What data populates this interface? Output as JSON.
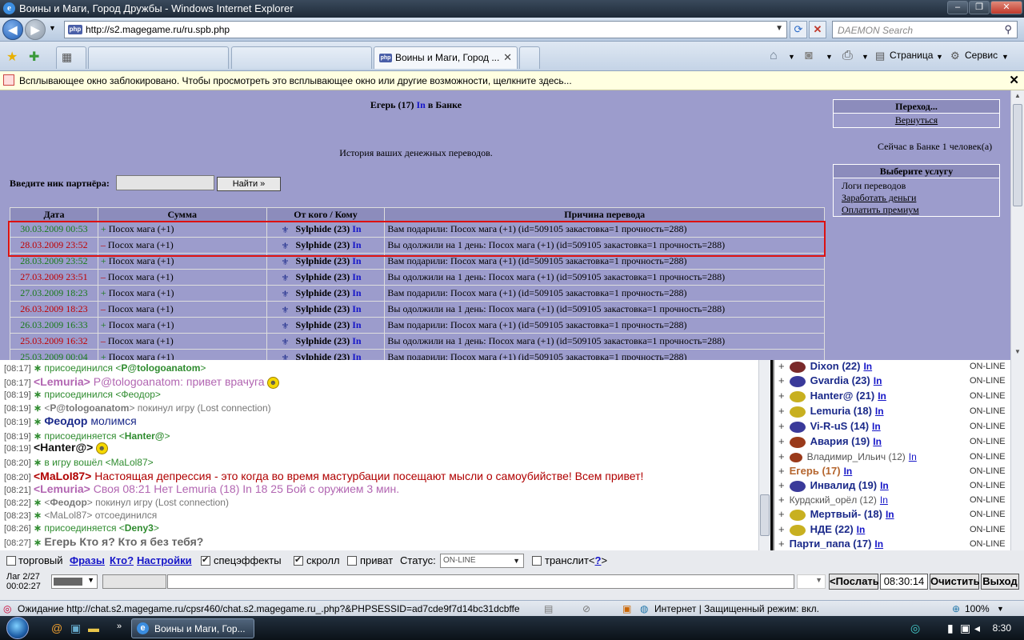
{
  "window": {
    "title": "Воины и Маги, Город Дружбы - Windows Internet Explorer",
    "minimize": "–",
    "maximize": "❐",
    "close": "✕"
  },
  "nav": {
    "url": "http://s2.magegame.ru/ru.spb.php",
    "search_placeholder": "DAEMON Search"
  },
  "tabs": {
    "active_title": "Воины и Маги, Город ...",
    "commands": [
      "Страница",
      "Сервис"
    ]
  },
  "infobar": {
    "text": "Всплывающее окно заблокировано. Чтобы просмотреть это всплывающее окно или другие возможности, щелкните здесь..."
  },
  "bank": {
    "header_name": "Егерь (17)",
    "header_in": "In",
    "header_place": "в Банке",
    "subtitle": "История ваших денежных переводов.",
    "partner_label": "Введите ник партнёра:",
    "find_button": "Найти »",
    "columns": [
      "Дата",
      "Сумма",
      "От кого / Кому",
      "Причина перевода"
    ],
    "rows": [
      {
        "date": "30.03.2009 00:53",
        "sign": "+",
        "amount": "Посох мага (+1)",
        "who": "Sylphide (23)",
        "in": "In",
        "reason": "Вам подарили: Посох мага (+1) (id=509105 закастовка=1 прочность=288)",
        "color": "#1a7a1a"
      },
      {
        "date": "28.03.2009 23:52",
        "sign": "–",
        "amount": "Посох мага (+1)",
        "who": "Sylphide (23)",
        "in": "In",
        "reason": "Вы одолжили на 1 день: Посох мага (+1) (id=509105 закастовка=1 прочность=288)",
        "color": "#c00000"
      },
      {
        "date": "28.03.2009 23:52",
        "sign": "+",
        "amount": "Посох мага (+1)",
        "who": "Sylphide (23)",
        "in": "In",
        "reason": "Вам подарили: Посох мага (+1) (id=509105 закастовка=1 прочность=288)",
        "color": "#1a7a1a"
      },
      {
        "date": "27.03.2009 23:51",
        "sign": "–",
        "amount": "Посох мага (+1)",
        "who": "Sylphide (23)",
        "in": "In",
        "reason": "Вы одолжили на 1 день: Посох мага (+1) (id=509105 закастовка=1 прочность=288)",
        "color": "#c00000"
      },
      {
        "date": "27.03.2009 18:23",
        "sign": "+",
        "amount": "Посох мага (+1)",
        "who": "Sylphide (23)",
        "in": "In",
        "reason": "Вам подарили: Посох мага (+1) (id=509105 закастовка=1 прочность=288)",
        "color": "#1a7a1a"
      },
      {
        "date": "26.03.2009 18:23",
        "sign": "–",
        "amount": "Посох мага (+1)",
        "who": "Sylphide (23)",
        "in": "In",
        "reason": "Вы одолжили на 1 день: Посох мага (+1) (id=509105 закастовка=1 прочность=288)",
        "color": "#c00000"
      },
      {
        "date": "26.03.2009 16:33",
        "sign": "+",
        "amount": "Посох мага (+1)",
        "who": "Sylphide (23)",
        "in": "In",
        "reason": "Вам подарили: Посох мага (+1) (id=509105 закастовка=1 прочность=288)",
        "color": "#1a7a1a"
      },
      {
        "date": "25.03.2009 16:32",
        "sign": "–",
        "amount": "Посох мага (+1)",
        "who": "Sylphide (23)",
        "in": "In",
        "reason": "Вы одолжили на 1 день: Посох мага (+1) (id=509105 закастовка=1 прочность=288)",
        "color": "#c00000"
      },
      {
        "date": "25.03.2009 00:04",
        "sign": "+",
        "amount": "Посох мага (+1)",
        "who": "Sylphide (23)",
        "in": "In",
        "reason": "Вам подарили: Посох мага (+1) (id=509105 закастовка=1 прочность=288)",
        "color": "#1a7a1a"
      }
    ],
    "nav_box": {
      "title": "Переход...",
      "link": "Вернуться"
    },
    "count_text": "Сейчас в Банке 1 человек(а)",
    "services_box": {
      "title": "Выберите услугу",
      "items": [
        "Логи переводов",
        "Заработать деньги",
        "Оплатить премиум"
      ]
    }
  },
  "chat": {
    "lines": [
      {
        "time": "[08:17]",
        "star": "∗",
        "parts": [
          {
            "t": "присоединился <",
            "c": "g"
          },
          {
            "t": "P@tologoanatom",
            "c": "nkb"
          },
          {
            "t": ">",
            "c": "g"
          }
        ]
      },
      {
        "time": "[08:17]",
        "parts": [
          {
            "t": "<Lemuria>",
            "c": "lemb"
          },
          {
            "t": " P@tologoanatom: привет врачуга",
            "c": "lem"
          }
        ],
        "smile": "😁"
      },
      {
        "time": "[08:19]",
        "star": "∗",
        "parts": [
          {
            "t": "присоединился <Феодор>",
            "c": "g"
          }
        ]
      },
      {
        "time": "[08:19]",
        "star": "∗",
        "parts": [
          {
            "t": "<",
            "c": "sys"
          },
          {
            "t": "P@tologoanatom",
            "c": "sysb"
          },
          {
            "t": "> покинул игру (Lost connection)",
            "c": "sys"
          }
        ]
      },
      {
        "time": "[08:19]",
        "star": "∗",
        "parts": [
          {
            "t": "Феодор",
            "c": "teo"
          },
          {
            "t": " молимся",
            "c": "teon"
          }
        ]
      },
      {
        "time": "[08:19]",
        "star": "∗",
        "parts": [
          {
            "t": "присоединяется <",
            "c": "g"
          },
          {
            "t": "Hanter@",
            "c": "nkb"
          },
          {
            "t": ">",
            "c": "g"
          }
        ]
      },
      {
        "time": "[08:19]",
        "parts": [
          {
            "t": "<Hanter@>",
            "c": "blkb"
          }
        ],
        "smile": "😁"
      },
      {
        "time": "[08:20]",
        "star": "∗",
        "parts": [
          {
            "t": "в игру вошёл <MaLol87>",
            "c": "g"
          }
        ]
      },
      {
        "time": "[08:20]",
        "parts": [
          {
            "t": "<MaLoI87>",
            "c": "malb"
          },
          {
            "t": " Настоящая депрессия - это когда во время мастурбации посещают мысли о самоубийстве! Всем привет!",
            "c": "mal"
          }
        ]
      },
      {
        "time": "[08:21]",
        "parts": [
          {
            "t": "<Lemuria>",
            "c": "lemb"
          },
          {
            "t": " Своя 08:21 Нет Lemuria (18) In 18 25 Бой с оружием 3 мин.",
            "c": "lem"
          }
        ]
      },
      {
        "time": "[08:22]",
        "star": "∗",
        "parts": [
          {
            "t": "<",
            "c": "sys"
          },
          {
            "t": "Феодор",
            "c": "sysb"
          },
          {
            "t": "> покинул игру (Lost connection)",
            "c": "sys"
          }
        ]
      },
      {
        "time": "[08:23]",
        "star": "∗",
        "parts": [
          {
            "t": "<MaLol87> отсоединился",
            "c": "sys"
          }
        ]
      },
      {
        "time": "[08:26]",
        "star": "∗",
        "parts": [
          {
            "t": "присоединяется <",
            "c": "g"
          },
          {
            "t": "Deny3",
            "c": "nkb"
          },
          {
            "t": ">",
            "c": "g"
          }
        ]
      },
      {
        "time": "[08:27]",
        "star": "∗",
        "parts": [
          {
            "t": "Егерь Кто я? Кто я без тебя?",
            "c": "egr"
          }
        ]
      }
    ]
  },
  "users": [
    {
      "name": "Dixon (22)",
      "in": "In",
      "status": "ON-LINE",
      "icon": "#7a2a2a",
      "style": "bold"
    },
    {
      "name": "Gvardia (23)",
      "in": "In",
      "status": "ON-LINE",
      "icon": "#3a3a9a",
      "style": "bold"
    },
    {
      "name": "Hanter@ (21)",
      "in": "In",
      "status": "ON-LINE",
      "icon": "#c8b020",
      "style": "bold"
    },
    {
      "name": "Lemuria (18)",
      "in": "In",
      "status": "ON-LINE",
      "icon": "#c8b020",
      "style": "bold"
    },
    {
      "name": "Vi-R-uS (14)",
      "in": "In",
      "status": "ON-LINE",
      "icon": "#3a3a9a",
      "style": "bold"
    },
    {
      "name": "Авария (19)",
      "in": "In",
      "status": "ON-LINE",
      "icon": "#9a3a1a",
      "style": "bold"
    },
    {
      "name": "Владимир_Ильич (12)",
      "in": "In",
      "status": "ON-LINE",
      "icon": "#9a3a1a",
      "style": "small"
    },
    {
      "name": "Егерь (17)",
      "in": "In",
      "status": "ON-LINE",
      "icon": "",
      "style": "orange"
    },
    {
      "name": "Инвалид (19)",
      "in": "In",
      "status": "ON-LINE",
      "icon": "#3a3a9a",
      "style": "bold"
    },
    {
      "name": "Курдский_орёл (12)",
      "in": "In",
      "status": "ON-LINE",
      "icon": "",
      "style": "small"
    },
    {
      "name": "Мертвый- (18)",
      "in": "In",
      "status": "ON-LINE",
      "icon": "#c8b020",
      "style": "bold"
    },
    {
      "name": "НДЕ (22)",
      "in": "In",
      "status": "ON-LINE",
      "icon": "#c8b020",
      "style": "bold"
    },
    {
      "name": "Парти_папа (17)",
      "in": "In",
      "status": "ON-LINE",
      "icon": "",
      "style": "bold"
    }
  ],
  "controls": {
    "trade_label": "торговый",
    "phrases": "Фразы",
    "who": "Кто?",
    "settings": "Настройки",
    "effects_label": "спецэффекты",
    "scroll_label": "скролл",
    "private_label": "приват",
    "status_label": "Статус:",
    "status_value": "ON-LINE",
    "translit_label": "транслит",
    "translit_help_open": "<",
    "translit_help": "?",
    "translit_help_close": ">",
    "lag_line1": "Лаг 2/27",
    "lag_line2": "00:02:27",
    "send": "<Послать",
    "time": "08:30:14",
    "clear": "Очистить",
    "exit": "Выход"
  },
  "statusbar": {
    "loading": "Ожидание http://chat.s2.magegame.ru/cpsr460/chat.s2.magegame.ru_.php?&PHPSESSID=ad7cde9f7d14bc31dcbffe91",
    "zone": "Интернет | Защищенный режим: вкл.",
    "zoom": "100%"
  },
  "taskbar": {
    "item": "Воины и Маги, Гор...",
    "clock": "8:30"
  }
}
